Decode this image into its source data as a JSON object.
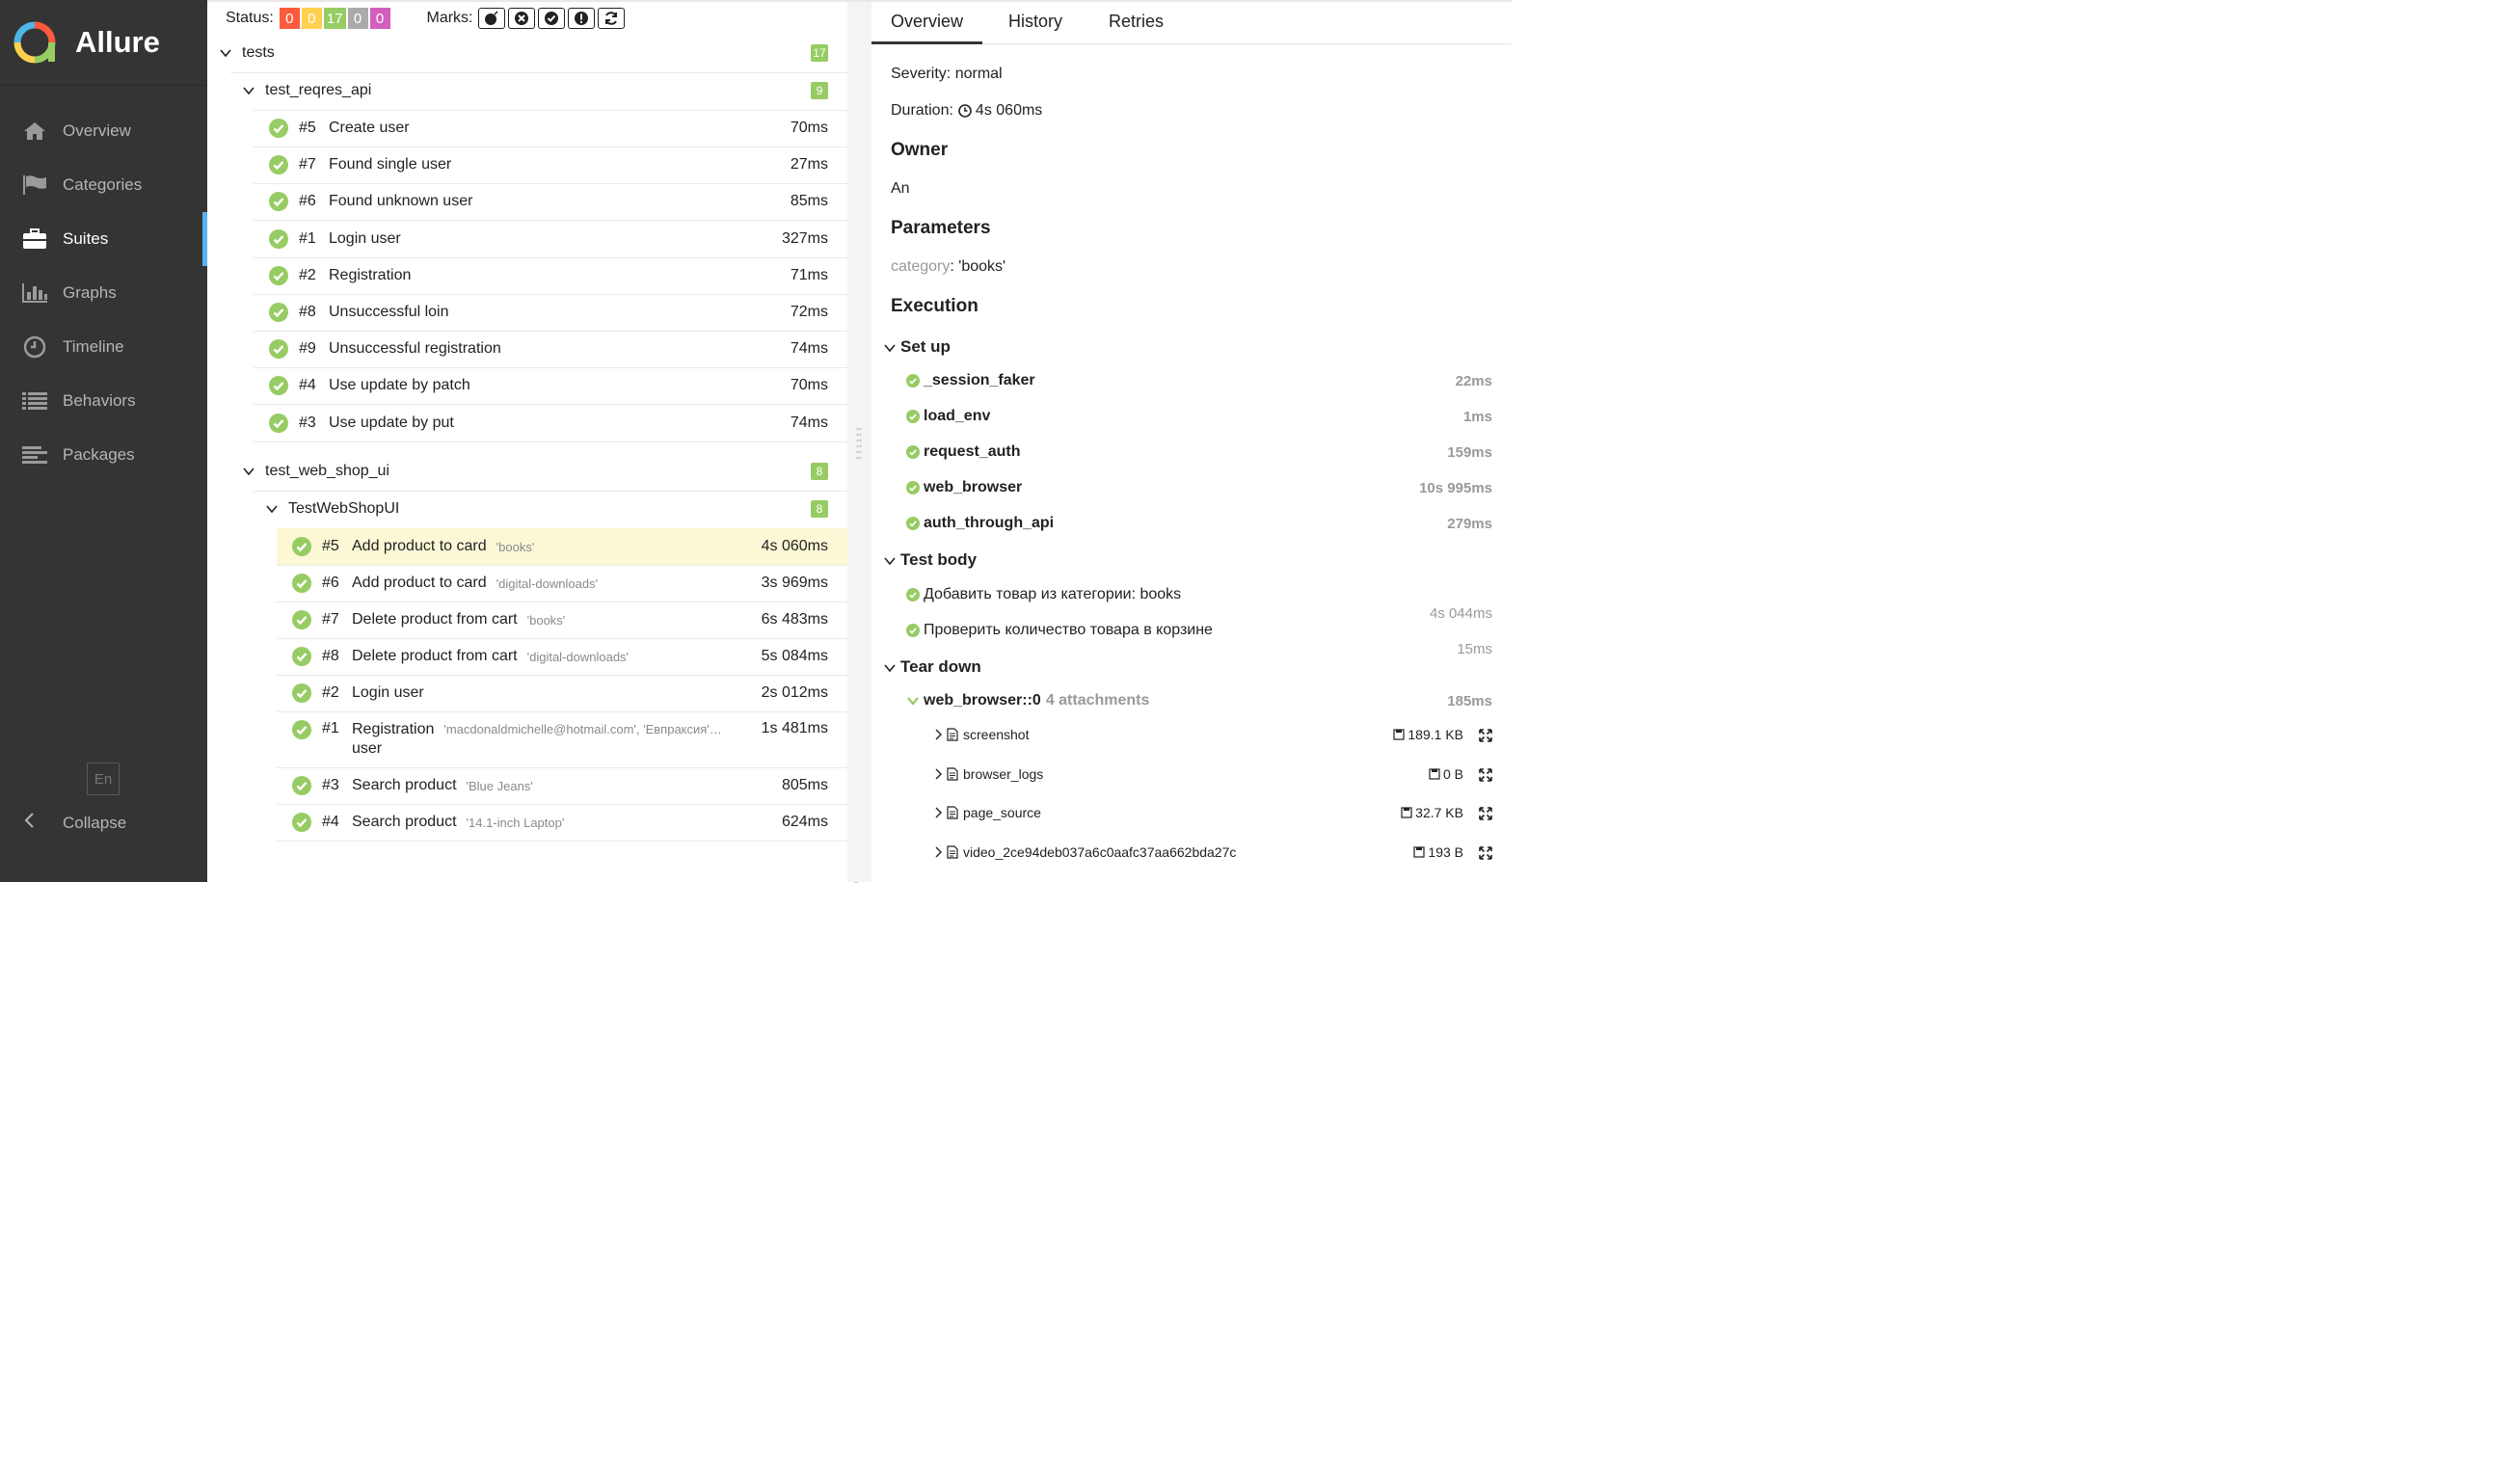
{
  "brand": {
    "name": "Allure"
  },
  "sidebar": {
    "items": [
      {
        "label": "Overview",
        "icon": "home-icon"
      },
      {
        "label": "Categories",
        "icon": "flag-icon"
      },
      {
        "label": "Suites",
        "icon": "briefcase-icon",
        "active": true
      },
      {
        "label": "Graphs",
        "icon": "bar-chart-icon"
      },
      {
        "label": "Timeline",
        "icon": "clock-icon"
      },
      {
        "label": "Behaviors",
        "icon": "list-icon"
      },
      {
        "label": "Packages",
        "icon": "align-left-icon"
      }
    ],
    "lang": "En",
    "collapse": "Collapse"
  },
  "statusbar": {
    "status_label": "Status:",
    "counts": [
      {
        "value": "0",
        "color": "#fd5a3e"
      },
      {
        "value": "0",
        "color": "#ffd050"
      },
      {
        "value": "17",
        "color": "#97cc64"
      },
      {
        "value": "0",
        "color": "#aaaaaa"
      },
      {
        "value": "0",
        "color": "#d35ebe"
      }
    ],
    "marks_label": "Marks:"
  },
  "tree": {
    "root": {
      "label": "tests",
      "count": "17"
    },
    "suite1": {
      "label": "test_reqres_api",
      "count": "9"
    },
    "suite1_tests": [
      {
        "num": "#5",
        "name": "Create user",
        "dur": "70ms"
      },
      {
        "num": "#7",
        "name": "Found single user",
        "dur": "27ms"
      },
      {
        "num": "#6",
        "name": "Found unknown user",
        "dur": "85ms"
      },
      {
        "num": "#1",
        "name": "Login user",
        "dur": "327ms"
      },
      {
        "num": "#2",
        "name": "Registration",
        "dur": "71ms"
      },
      {
        "num": "#8",
        "name": "Unsuccessful loin",
        "dur": "72ms"
      },
      {
        "num": "#9",
        "name": "Unsuccessful registration",
        "dur": "74ms"
      },
      {
        "num": "#4",
        "name": "Use update by patch",
        "dur": "70ms"
      },
      {
        "num": "#3",
        "name": "Use update by put",
        "dur": "74ms"
      }
    ],
    "suite2": {
      "label": "test_web_shop_ui",
      "count": "8"
    },
    "cls": {
      "label": "TestWebShopUI",
      "count": "8"
    },
    "cls_tests": [
      {
        "num": "#5",
        "name": "Add product to card",
        "param": "'books'",
        "dur": "4s 060ms"
      },
      {
        "num": "#6",
        "name": "Add product to card",
        "param": "'digital-downloads'",
        "dur": "3s 969ms"
      },
      {
        "num": "#7",
        "name": "Delete product from cart",
        "param": "'books'",
        "dur": "6s 483ms"
      },
      {
        "num": "#8",
        "name": "Delete product from cart",
        "param": "'digital-downloads'",
        "dur": "5s 084ms"
      },
      {
        "num": "#2",
        "name": "Login user",
        "param": "",
        "dur": "2s 012ms"
      },
      {
        "num": "#1",
        "name": "Registration",
        "name2": "user",
        "param": "'macdonaldmichelle@hotmail.com', 'Евпраксия'…",
        "dur": "1s 481ms"
      },
      {
        "num": "#3",
        "name": "Search product",
        "param": "'Blue Jeans'",
        "dur": "805ms"
      },
      {
        "num": "#4",
        "name": "Search product",
        "param": "'14.1-inch Laptop'",
        "dur": "624ms"
      }
    ]
  },
  "detail": {
    "tabs": [
      "Overview",
      "History",
      "Retries"
    ],
    "severity": "Severity: normal",
    "duration_label": "Duration:",
    "duration": "4s 060ms",
    "owner_h": "Owner",
    "owner": "An",
    "params_h": "Parameters",
    "param_key": "category",
    "param_val": ": 'books'",
    "exec_h": "Execution",
    "setup_h": "Set up",
    "setup": [
      {
        "name": "_session_faker",
        "dur": "22ms"
      },
      {
        "name": "load_env",
        "dur": "1ms"
      },
      {
        "name": "request_auth",
        "dur": "159ms"
      },
      {
        "name": "web_browser",
        "dur": "10s 995ms"
      },
      {
        "name": "auth_through_api",
        "dur": "279ms"
      }
    ],
    "body_h": "Test body",
    "body": [
      {
        "name": "Добавить товар из категории: books",
        "dur": "4s 044ms"
      },
      {
        "name": "Проверить количество товара в корзине",
        "dur": "15ms"
      }
    ],
    "teardown_h": "Tear down",
    "teardown_step": {
      "name": "web_browser::0",
      "note": "4 attachments",
      "dur": "185ms"
    },
    "attachments": [
      {
        "name": "screenshot",
        "size": "189.1 KB",
        "icon": "image-file-icon"
      },
      {
        "name": "browser_logs",
        "size": "0 B",
        "icon": "text-file-icon"
      },
      {
        "name": "page_source",
        "size": "32.7 KB",
        "icon": "code-file-icon"
      },
      {
        "name": "video_2ce94deb037a6c0aafc37aa662bda27c",
        "size": "193 B",
        "icon": "video-file-icon"
      }
    ]
  }
}
